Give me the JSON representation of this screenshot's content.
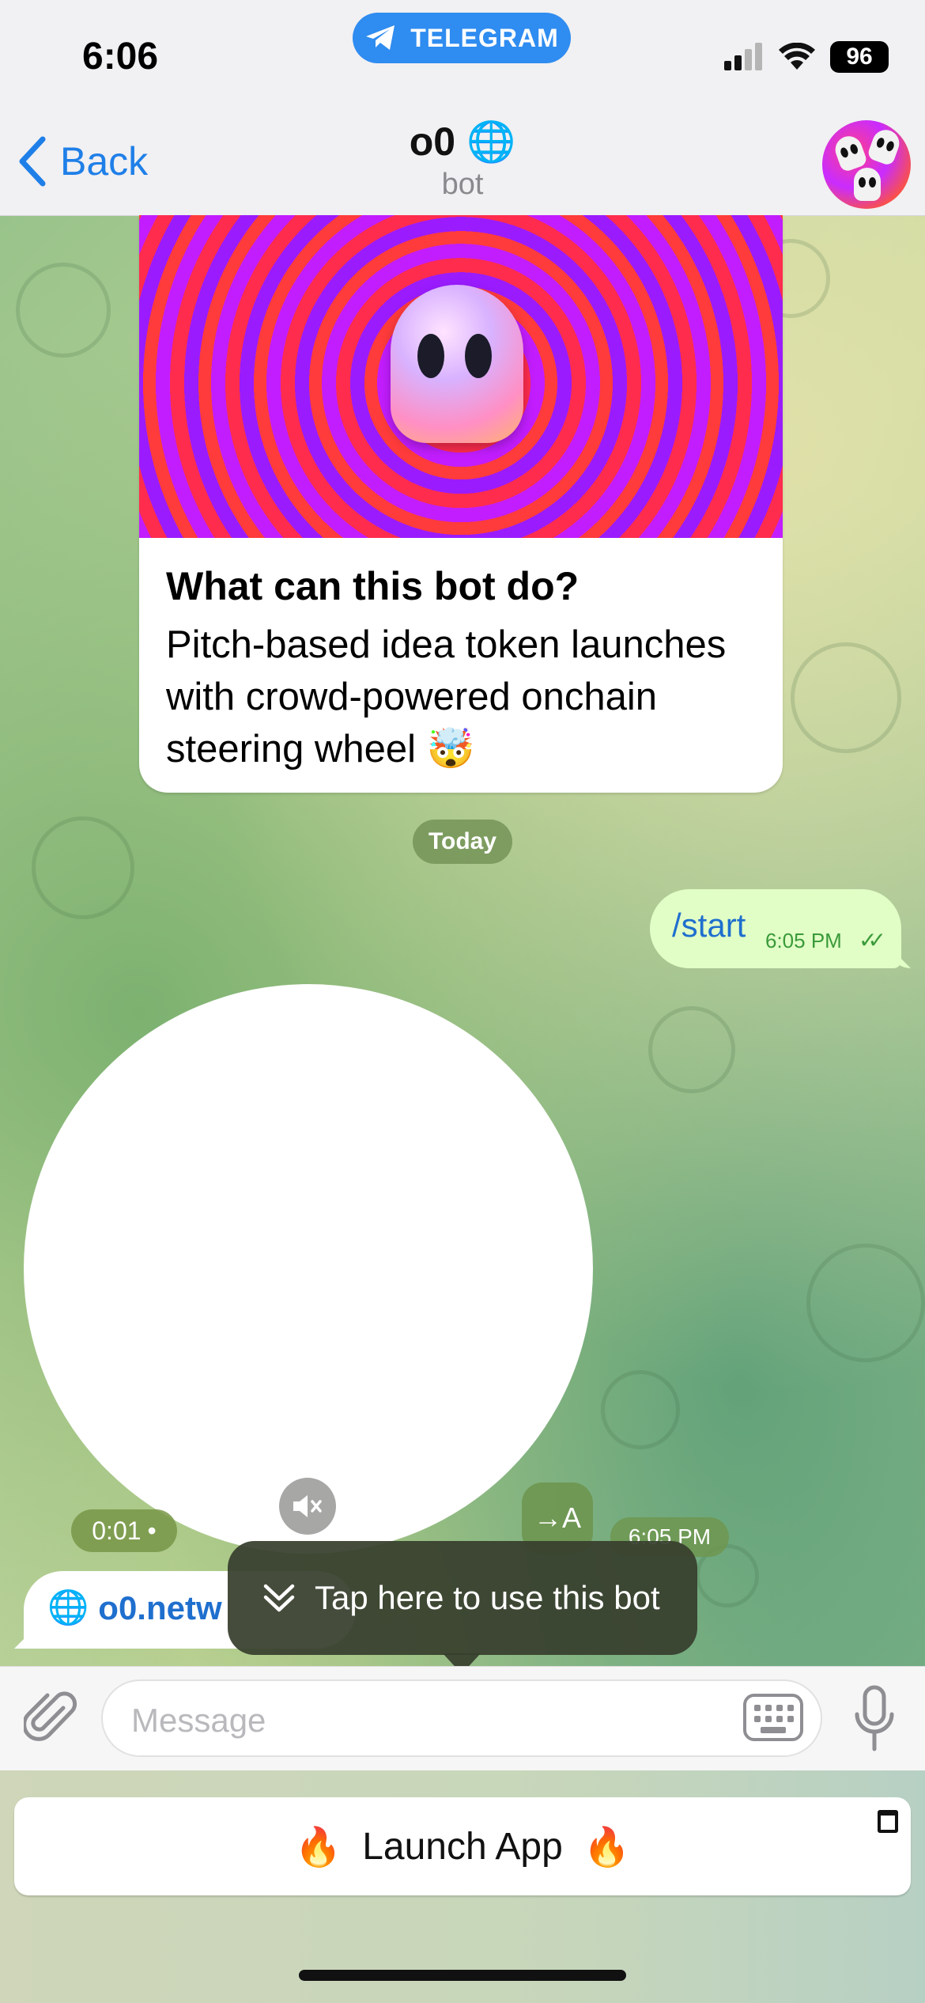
{
  "status_bar": {
    "time": "6:06",
    "app_pill": "TELEGRAM",
    "battery": "96"
  },
  "header": {
    "back_label": "Back",
    "title": "o0 🌐",
    "subtitle": "bot"
  },
  "intro_card": {
    "heading": "What can this bot do?",
    "description": "Pitch-based idea token launches with crowd-powered onchain steering wheel 🤯"
  },
  "date_divider": "Today",
  "outgoing_message": {
    "text": "/start",
    "time": "6:05 PM"
  },
  "video_message": {
    "duration": "0:01",
    "translate_label": "→A",
    "time": "6:05 PM"
  },
  "incoming_link": {
    "text": "o0.netw"
  },
  "tooltip": {
    "text": "Tap here to use this bot"
  },
  "composer": {
    "placeholder": "Message"
  },
  "bot_keyboard": {
    "button_label": "Launch App",
    "emoji": "🔥"
  },
  "colors": {
    "accent": "#2f8cf0",
    "link": "#1f6fce",
    "outgoing_bubble": "#e1fec6"
  }
}
